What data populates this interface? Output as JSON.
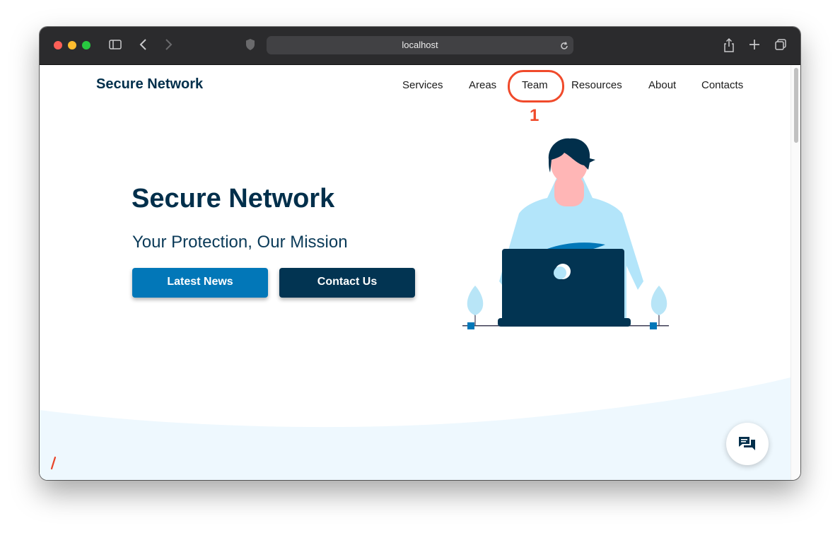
{
  "browser": {
    "url": "localhost"
  },
  "nav": {
    "brand": "Secure Network",
    "items": [
      "Services",
      "Areas",
      "Team",
      "Resources",
      "About",
      "Contacts"
    ]
  },
  "annotation": {
    "step_number": "1",
    "color": "#f04a2b"
  },
  "hero": {
    "title": "Secure Network",
    "subtitle": "Your Protection, Our Mission",
    "primary_button": "Latest News",
    "secondary_button": "Contact Us"
  },
  "colors": {
    "brand_dark": "#012f4b",
    "primary_blue": "#0277b8",
    "light_wave": "#eef8fe"
  },
  "icons": {
    "chat": "chat-bubbles-icon"
  }
}
